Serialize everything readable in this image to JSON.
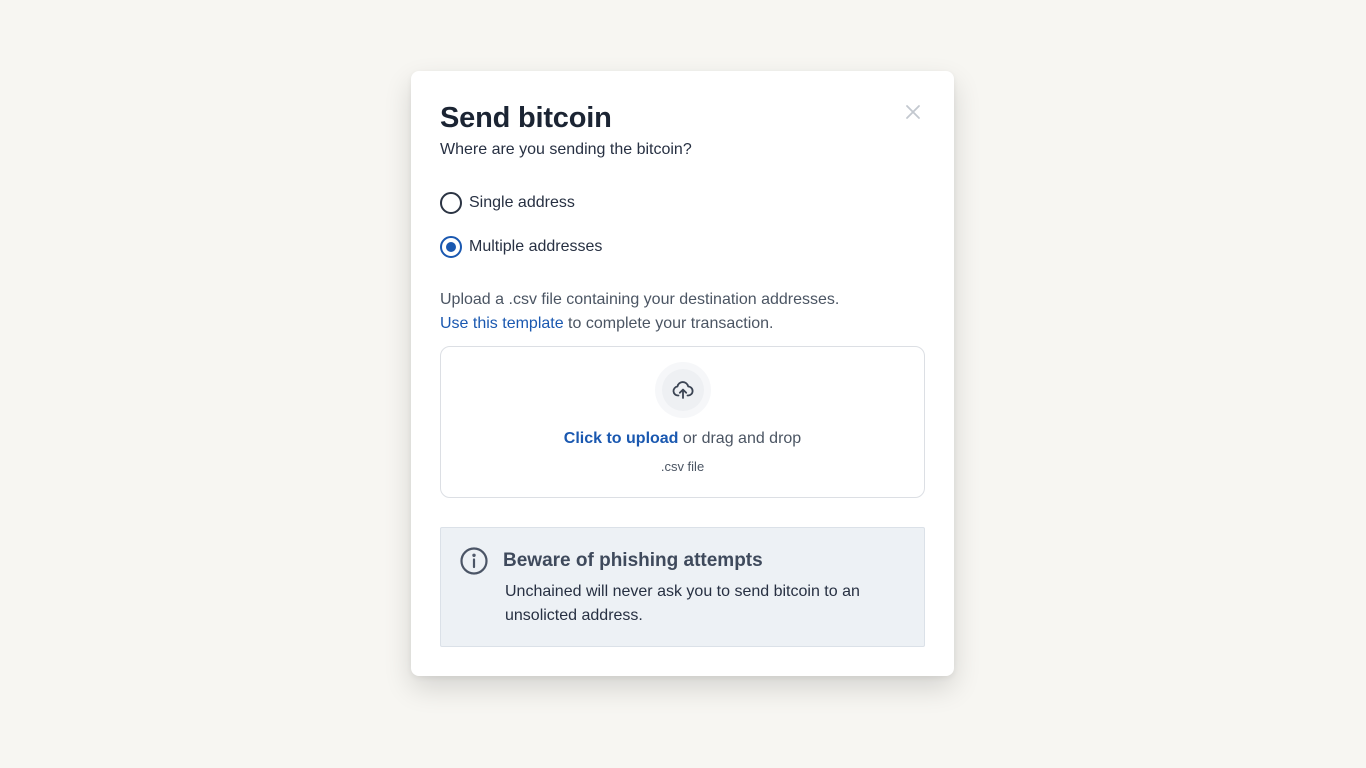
{
  "modal": {
    "title": "Send bitcoin",
    "subtitle": "Where are you sending the bitcoin?",
    "close_icon": "close-icon"
  },
  "recipient_options": {
    "options": [
      {
        "label": "Single address",
        "selected": false
      },
      {
        "label": "Multiple addresses",
        "selected": true
      }
    ]
  },
  "instructions": {
    "line1": "Upload a .csv file containing your destination addresses.",
    "template_link": "Use this template",
    "line2_rest": " to complete your transaction."
  },
  "upload": {
    "icon": "cloud-upload-icon",
    "cta": "Click to upload",
    "rest": " or drag and drop",
    "hint": ".csv file"
  },
  "alert": {
    "icon": "info-icon",
    "title": "Beware of phishing attempts",
    "body": "Unchained will never ask you to send bitcoin to an unsolicted address."
  },
  "colors": {
    "accent": "#1a58b0",
    "background": "#f7f6f2",
    "alert_bg": "#edf1f5"
  }
}
